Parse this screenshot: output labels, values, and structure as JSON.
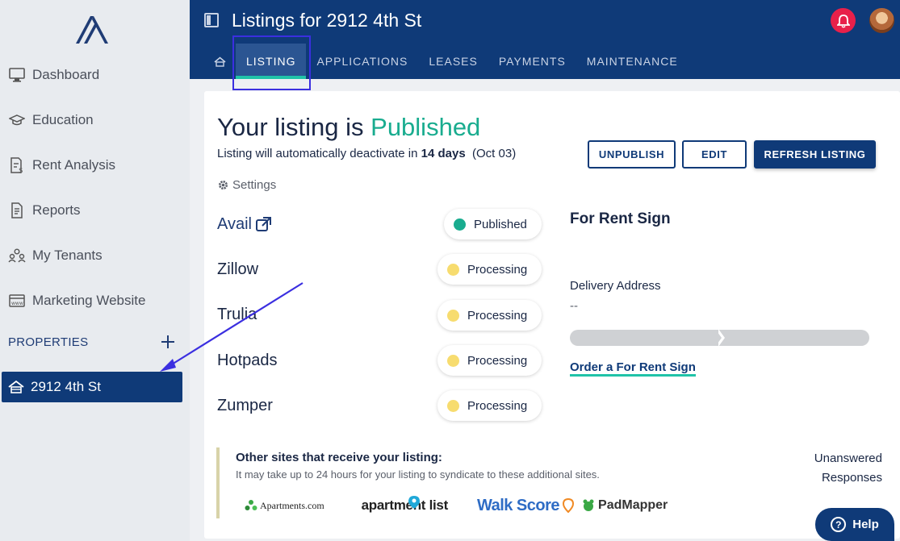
{
  "header": {
    "title": "Listings for 2912 4th St",
    "tabs": [
      "LISTING",
      "APPLICATIONS",
      "LEASES",
      "PAYMENTS",
      "MAINTENANCE"
    ],
    "active_tab": "LISTING"
  },
  "sidebar": {
    "items": [
      {
        "label": "Dashboard",
        "icon": "monitor-icon"
      },
      {
        "label": "Education",
        "icon": "graduation-cap-icon"
      },
      {
        "label": "Rent Analysis",
        "icon": "rent-analysis-icon"
      },
      {
        "label": "Reports",
        "icon": "report-icon"
      },
      {
        "label": "My Tenants",
        "icon": "people-icon"
      },
      {
        "label": "Marketing Website",
        "icon": "www-icon"
      }
    ],
    "properties_label": "PROPERTIES",
    "property": "2912 4th St"
  },
  "listing": {
    "title_prefix": "Your listing is",
    "status": "Published",
    "deactivate_prefix": "Listing will automatically deactivate in",
    "deactivate_days": "14 days",
    "deactivate_date": "(Oct 03)",
    "buttons": {
      "unpublish": "UNPUBLISH",
      "edit": "EDIT",
      "refresh": "REFRESH LISTING"
    },
    "settings": "Settings"
  },
  "sites": [
    {
      "name": "Avail",
      "status": "Published",
      "color": "#19ac8f"
    },
    {
      "name": "Zillow",
      "status": "Processing",
      "color": "#f7dc6f"
    },
    {
      "name": "Trulia",
      "status": "Processing",
      "color": "#f7dc6f"
    },
    {
      "name": "Hotpads",
      "status": "Processing",
      "color": "#f7dc6f"
    },
    {
      "name": "Zumper",
      "status": "Processing",
      "color": "#f7dc6f"
    }
  ],
  "for_rent_sign": {
    "title": "For Rent Sign",
    "delivery_label": "Delivery Address",
    "delivery_value": "--",
    "order_link": "Order a For Rent Sign"
  },
  "other_sites": {
    "title": "Other sites that receive your listing:",
    "subtitle": "It may take up to 24 hours for your listing to syndicate to these additional sites.",
    "logos": [
      "Apartments.com",
      "apartment list",
      "Walk Score",
      "PadMapper"
    ]
  },
  "unanswered": {
    "line1": "Unanswered",
    "line2": "Responses"
  },
  "help": "Help",
  "colors": {
    "navy": "#0f3a78",
    "teal": "#19ac8f",
    "accent_line": "#20c3a8",
    "processing": "#f7dc6f",
    "annotation": "#3b2fe0"
  }
}
